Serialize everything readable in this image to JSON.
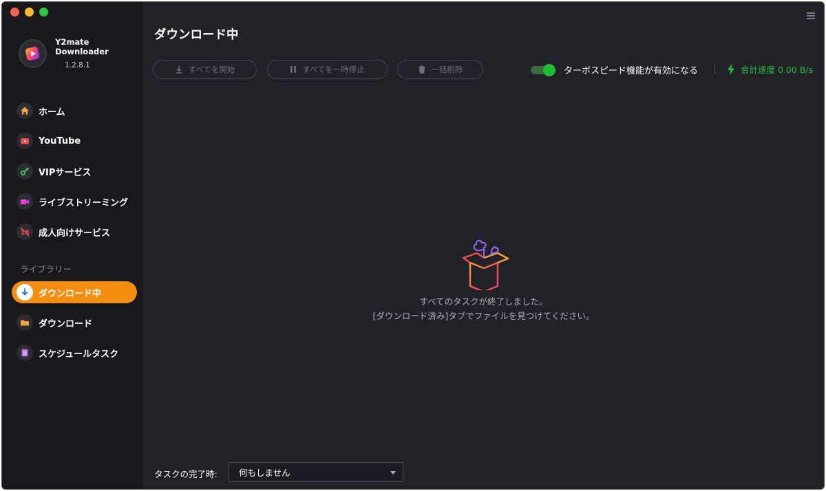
{
  "app": {
    "name": "Y2mate Downloader",
    "version": "1.2.8.1"
  },
  "sidebar": {
    "items": [
      {
        "label": "ホーム",
        "icon": "home-icon"
      },
      {
        "label": "YouTube",
        "icon": "youtube-icon"
      },
      {
        "label": "VIPサービス",
        "icon": "key-icon"
      },
      {
        "label": "ライブストリーミング",
        "icon": "video-camera-icon"
      },
      {
        "label": "成人向けサービス",
        "icon": "no-18-icon"
      }
    ],
    "library_label": "ライブラリー",
    "library_items": [
      {
        "label": "ダウンロード中",
        "icon": "download-arrow-icon",
        "active": true
      },
      {
        "label": "ダウンロード",
        "icon": "folder-icon"
      },
      {
        "label": "スケジュールタスク",
        "icon": "schedule-list-icon"
      }
    ]
  },
  "main": {
    "title": "ダウンロード中",
    "toolbar": {
      "start_all": "すべてを開始",
      "pause_all": "すべてを一時停止",
      "delete_all": "一括削除"
    },
    "turbo_label": "ターボスピード機能が有効になる",
    "turbo_enabled": true,
    "speed_label": "合計速度 0.00 B/s",
    "empty_line1": "すべてのタスクが終了しました。",
    "empty_line2": "[ダウンロード済み]タブでファイルを見つけてください。",
    "footer_label": "タスクの完了時:",
    "footer_select_value": "何もしません"
  },
  "colors": {
    "accent": "#f38e11",
    "turbo_green": "#1fbf33",
    "background": "#212128",
    "sidebar": "#18181d"
  }
}
